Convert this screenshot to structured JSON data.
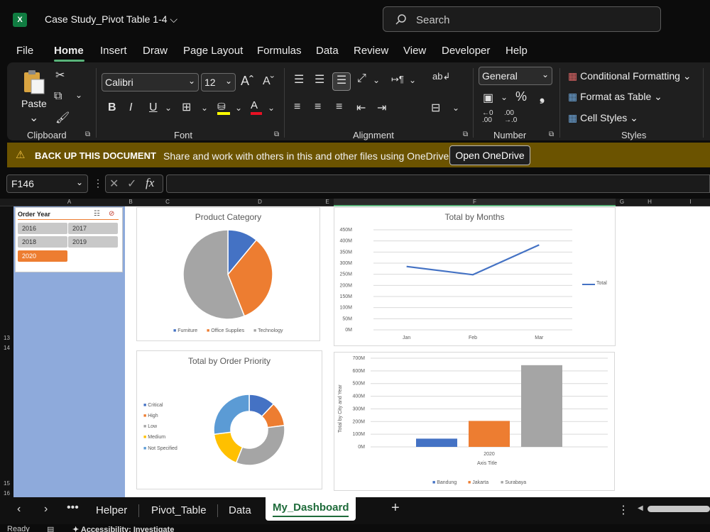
{
  "title_bar": {
    "app_icon": "X",
    "doc_title": "Case Study_Pivot Table 1-4",
    "search_placeholder": "Search"
  },
  "menu": [
    "File",
    "Home",
    "Insert",
    "Draw",
    "Page Layout",
    "Formulas",
    "Data",
    "Review",
    "View",
    "Developer",
    "Help"
  ],
  "ribbon": {
    "paste_label": "Paste",
    "font_name": "Calibri",
    "font_size": "12",
    "number_format": "General",
    "groups": {
      "clipboard": "Clipboard",
      "font": "Font",
      "alignment": "Alignment",
      "number": "Number",
      "styles": "Styles"
    },
    "styles_items": [
      "Conditional Formatting",
      "Format as Table",
      "Cell Styles"
    ]
  },
  "banner": {
    "title": "BACK UP THIS DOCUMENT",
    "message": "Share and work with others in this and other files using OneDrive.",
    "button": "Open OneDrive"
  },
  "formula_bar": {
    "name_box": "F146",
    "fx": "fx",
    "formula": ""
  },
  "columns": [
    "A",
    "B",
    "C",
    "D",
    "E",
    "F",
    "G",
    "H",
    "I"
  ],
  "rows": [
    "13",
    "14",
    "15",
    "16"
  ],
  "slicer": {
    "title": "Order Year",
    "items": [
      "2016",
      "2017",
      "2018",
      "2019",
      "2020"
    ],
    "selected": "2020"
  },
  "colors": {
    "blue": "#4472c4",
    "orange": "#ed7d31",
    "gray": "#a5a5a5",
    "yellow": "#ffc000",
    "lightblue": "#5b9bd5",
    "accent_green": "#107c41"
  },
  "charts": {
    "product_category": {
      "title": "Product Category",
      "legend": [
        "Furniture",
        "Office Supplies",
        "Technology"
      ]
    },
    "total_by_months": {
      "title": "Total by Months",
      "legend": [
        "Total"
      ]
    },
    "order_priority": {
      "title": "Total by Order Priority",
      "legend": [
        "Critical",
        "High",
        "Low",
        "Medium",
        "Not Specified"
      ]
    },
    "city_year": {
      "title": "",
      "ylabel": "Total by City and Year",
      "xlabel": "Axis Title",
      "legend": [
        "Bandung",
        "Jakarta",
        "Surabaya"
      ]
    }
  },
  "chart_data": [
    {
      "type": "pie",
      "title": "Product Category",
      "categories": [
        "Furniture",
        "Office Supplies",
        "Technology"
      ],
      "values": [
        11,
        33,
        56
      ]
    },
    {
      "type": "line",
      "title": "Total by Months",
      "categories": [
        "Jan",
        "Feb",
        "Mar"
      ],
      "series": [
        {
          "name": "Total",
          "values": [
            285,
            248,
            382
          ]
        }
      ],
      "yticks": [
        "0M",
        "50M",
        "100M",
        "150M",
        "200M",
        "250M",
        "300M",
        "350M",
        "400M",
        "450M"
      ],
      "ylim": [
        0,
        450
      ],
      "legend": "right"
    },
    {
      "type": "pie",
      "title": "Total by Order Priority",
      "categories": [
        "Critical",
        "High",
        "Low",
        "Medium",
        "Not Specified"
      ],
      "values": [
        12,
        11,
        33,
        17,
        27
      ]
    },
    {
      "type": "bar",
      "categories": [
        "2020"
      ],
      "series": [
        {
          "name": "Bandung",
          "values": [
            65
          ]
        },
        {
          "name": "Jakarta",
          "values": [
            205
          ]
        },
        {
          "name": "Surabaya",
          "values": [
            645
          ]
        }
      ],
      "yticks": [
        "0M",
        "100M",
        "200M",
        "300M",
        "400M",
        "500M",
        "600M",
        "700M"
      ],
      "ylim": [
        0,
        700
      ],
      "ylabel": "Total by City and Year",
      "xlabel": "Axis Title",
      "legend": "bottom"
    }
  ],
  "sheet_tabs": {
    "tabs": [
      "Helper",
      "Pivot_Table",
      "Data",
      "My_Dashboard"
    ],
    "active": "My_Dashboard"
  },
  "status": {
    "ready": "Ready",
    "accessibility": "Accessibility: Investigate"
  }
}
